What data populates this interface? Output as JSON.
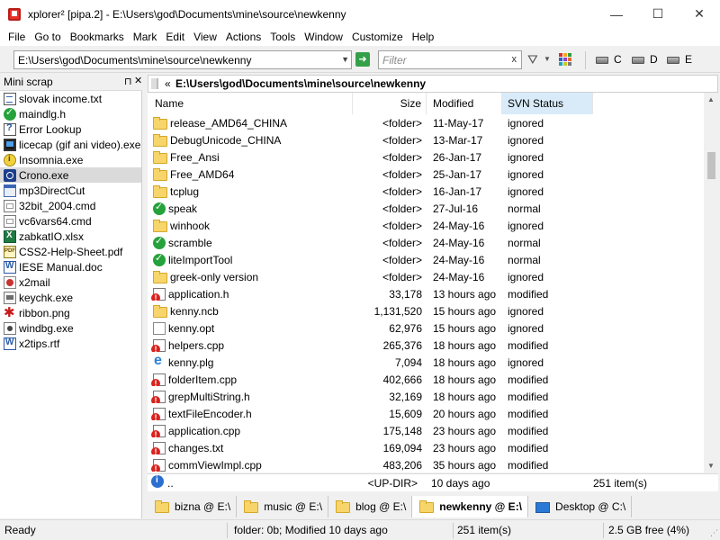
{
  "window": {
    "title": "xplorer² [pipa.2] - E:\\Users\\god\\Documents\\mine\\source\\newkenny",
    "minimize": "—",
    "maximize": "☐",
    "close": "✕"
  },
  "menu": [
    "File",
    "Go to",
    "Bookmarks",
    "Mark",
    "Edit",
    "View",
    "Actions",
    "Tools",
    "Window",
    "Customize",
    "Help"
  ],
  "toolbar": {
    "address": "E:\\Users\\god\\Documents\\mine\\source\\newkenny",
    "filter_placeholder": "Filter",
    "filter_clear": "x",
    "drives": [
      "C",
      "D",
      "E"
    ],
    "colors": [
      "#d93025",
      "#f2a81d",
      "#2e9a47",
      "#2a63c8",
      "#9b3fc2",
      "#e86a2a",
      "#1aa7b5",
      "#c9c92a",
      "#7a7a7a"
    ]
  },
  "mini_scrap": {
    "title": "Mini scrap",
    "pin": "⊓",
    "close": "✕",
    "items": [
      {
        "icon": "text-file-icon",
        "label": "slovak income.txt"
      },
      {
        "icon": "svn-normal-icon",
        "label": "maindlg.h"
      },
      {
        "icon": "help-file-icon",
        "label": "Error Lookup"
      },
      {
        "icon": "licecap-icon",
        "label": "licecap (gif ani video).exe"
      },
      {
        "icon": "insomnia-icon",
        "label": "Insomnia.exe"
      },
      {
        "icon": "crono-icon",
        "label": "Crono.exe"
      },
      {
        "icon": "window-icon",
        "label": "mp3DirectCut"
      },
      {
        "icon": "cmd-file-icon",
        "label": "32bit_2004.cmd"
      },
      {
        "icon": "cmd-file-icon",
        "label": "vc6vars64.cmd"
      },
      {
        "icon": "excel-file-icon",
        "label": "zabkatIO.xlsx"
      },
      {
        "icon": "pdf-file-icon",
        "label": "CSS2-Help-Sheet.pdf"
      },
      {
        "icon": "word-file-icon",
        "label": "IESE Manual.doc"
      },
      {
        "icon": "x2mail-icon",
        "label": "x2mail"
      },
      {
        "icon": "keychk-icon",
        "label": "keychk.exe"
      },
      {
        "icon": "ribbon-image-icon",
        "label": "ribbon.png"
      },
      {
        "icon": "windbg-icon",
        "label": "windbg.exe"
      },
      {
        "icon": "word-file-icon",
        "label": "x2tips.rtf"
      }
    ],
    "selected_index": 5
  },
  "path_bar": {
    "chevron": "«",
    "path": "E:\\Users\\god\\Documents\\mine\\source\\newkenny"
  },
  "columns": {
    "name": "Name",
    "size": "Size",
    "modified": "Modified",
    "svn": "SVN Status"
  },
  "files": [
    {
      "icon": "folder",
      "name": "release_AMD64_CHINA",
      "size": "<folder>",
      "modified": "11-May-17",
      "svn": "ignored"
    },
    {
      "icon": "folder",
      "name": "DebugUnicode_CHINA",
      "size": "<folder>",
      "modified": "13-Mar-17",
      "svn": "ignored"
    },
    {
      "icon": "folder",
      "name": "Free_Ansi",
      "size": "<folder>",
      "modified": "26-Jan-17",
      "svn": "ignored"
    },
    {
      "icon": "folder",
      "name": "Free_AMD64",
      "size": "<folder>",
      "modified": "25-Jan-17",
      "svn": "ignored"
    },
    {
      "icon": "folder",
      "name": "tcplug",
      "size": "<folder>",
      "modified": "16-Jan-17",
      "svn": "ignored"
    },
    {
      "icon": "svn-normal",
      "name": "speak",
      "size": "<folder>",
      "modified": "27-Jul-16",
      "svn": "normal"
    },
    {
      "icon": "folder",
      "name": "winhook",
      "size": "<folder>",
      "modified": "24-May-16",
      "svn": "ignored"
    },
    {
      "icon": "svn-normal",
      "name": "scramble",
      "size": "<folder>",
      "modified": "24-May-16",
      "svn": "normal"
    },
    {
      "icon": "svn-normal",
      "name": "liteImportTool",
      "size": "<folder>",
      "modified": "24-May-16",
      "svn": "normal"
    },
    {
      "icon": "folder",
      "name": "greek-only version",
      "size": "<folder>",
      "modified": "24-May-16",
      "svn": "ignored"
    },
    {
      "icon": "svn-modified",
      "name": "application.h",
      "size": "33,178",
      "modified": "13 hours ago",
      "svn": "modified"
    },
    {
      "icon": "folder",
      "name": "kenny.ncb",
      "size": "1,131,520",
      "modified": "15 hours ago",
      "svn": "ignored"
    },
    {
      "icon": "plain",
      "name": "kenny.opt",
      "size": "62,976",
      "modified": "15 hours ago",
      "svn": "ignored"
    },
    {
      "icon": "svn-modified",
      "name": "helpers.cpp",
      "size": "265,376",
      "modified": "18 hours ago",
      "svn": "modified"
    },
    {
      "icon": "ie",
      "name": "kenny.plg",
      "size": "7,094",
      "modified": "18 hours ago",
      "svn": "ignored"
    },
    {
      "icon": "svn-modified",
      "name": "folderItem.cpp",
      "size": "402,666",
      "modified": "18 hours ago",
      "svn": "modified"
    },
    {
      "icon": "svn-modified",
      "name": "grepMultiString.h",
      "size": "32,169",
      "modified": "18 hours ago",
      "svn": "modified"
    },
    {
      "icon": "svn-modified",
      "name": "textFileEncoder.h",
      "size": "15,609",
      "modified": "20 hours ago",
      "svn": "modified"
    },
    {
      "icon": "svn-modified",
      "name": "application.cpp",
      "size": "175,148",
      "modified": "23 hours ago",
      "svn": "modified"
    },
    {
      "icon": "svn-modified",
      "name": "changes.txt",
      "size": "169,094",
      "modified": "23 hours ago",
      "svn": "modified"
    },
    {
      "icon": "svn-modified",
      "name": "commViewImpl.cpp",
      "size": "483,206",
      "modified": "35 hours ago",
      "svn": "modified"
    }
  ],
  "updir_row": {
    "name": "..",
    "size": "<UP-DIR>",
    "modified": "10 days ago",
    "count": "251 item(s)"
  },
  "tabs": [
    {
      "label": "bizna @ E:\\",
      "icon": "folder"
    },
    {
      "label": "music @ E:\\",
      "icon": "folder"
    },
    {
      "label": "blog @ E:\\",
      "icon": "folder"
    },
    {
      "label": "newkenny @ E:\\",
      "icon": "folder",
      "active": true
    },
    {
      "label": "Desktop @ C:\\",
      "icon": "desktop"
    }
  ],
  "status": {
    "ready": "Ready",
    "folder_info": "folder: 0b; Modified 10 days ago",
    "items": "251 item(s)",
    "free": "2.5 GB free (4%)"
  }
}
